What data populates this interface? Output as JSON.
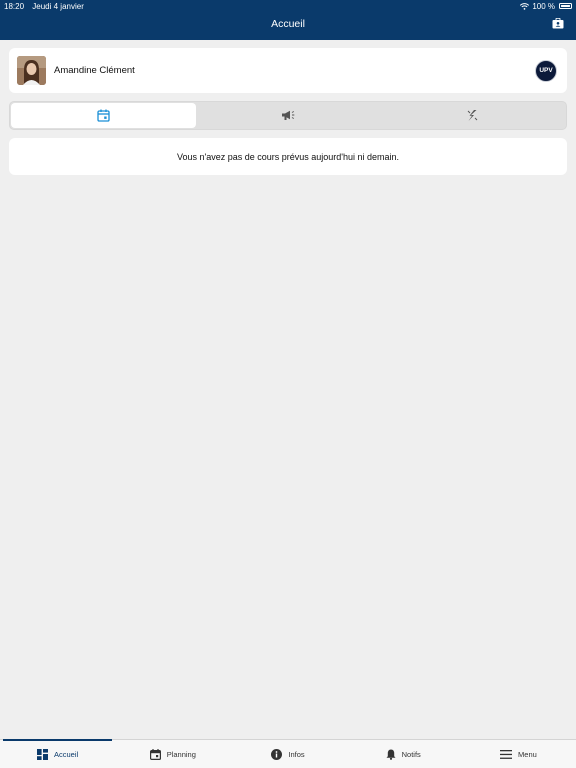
{
  "status_bar": {
    "time": "18:20",
    "date": "Jeudi 4 janvier",
    "battery": "100 %"
  },
  "header": {
    "title": "Accueil"
  },
  "profile": {
    "name": "Amandine Clément",
    "school_logo_text": "UPV"
  },
  "tabs": [
    {
      "icon": "calendar-icon",
      "active": true
    },
    {
      "icon": "megaphone-icon",
      "active": false
    },
    {
      "icon": "lightning-icon",
      "active": false
    }
  ],
  "message": "Vous n'avez pas de cours prévus aujourd'hui ni demain.",
  "bottom_nav": {
    "items": [
      {
        "label": "Accueil",
        "icon": "dashboard-icon",
        "active": true
      },
      {
        "label": "Planning",
        "icon": "calendar-icon",
        "active": false
      },
      {
        "label": "Infos",
        "icon": "info-icon",
        "active": false
      },
      {
        "label": "Notifs",
        "icon": "bell-icon",
        "active": false
      },
      {
        "label": "Menu",
        "icon": "hamburger-icon",
        "active": false
      }
    ]
  },
  "colors": {
    "primary": "#0a3a6b",
    "accent": "#1a8fd6",
    "background": "#efefef"
  }
}
